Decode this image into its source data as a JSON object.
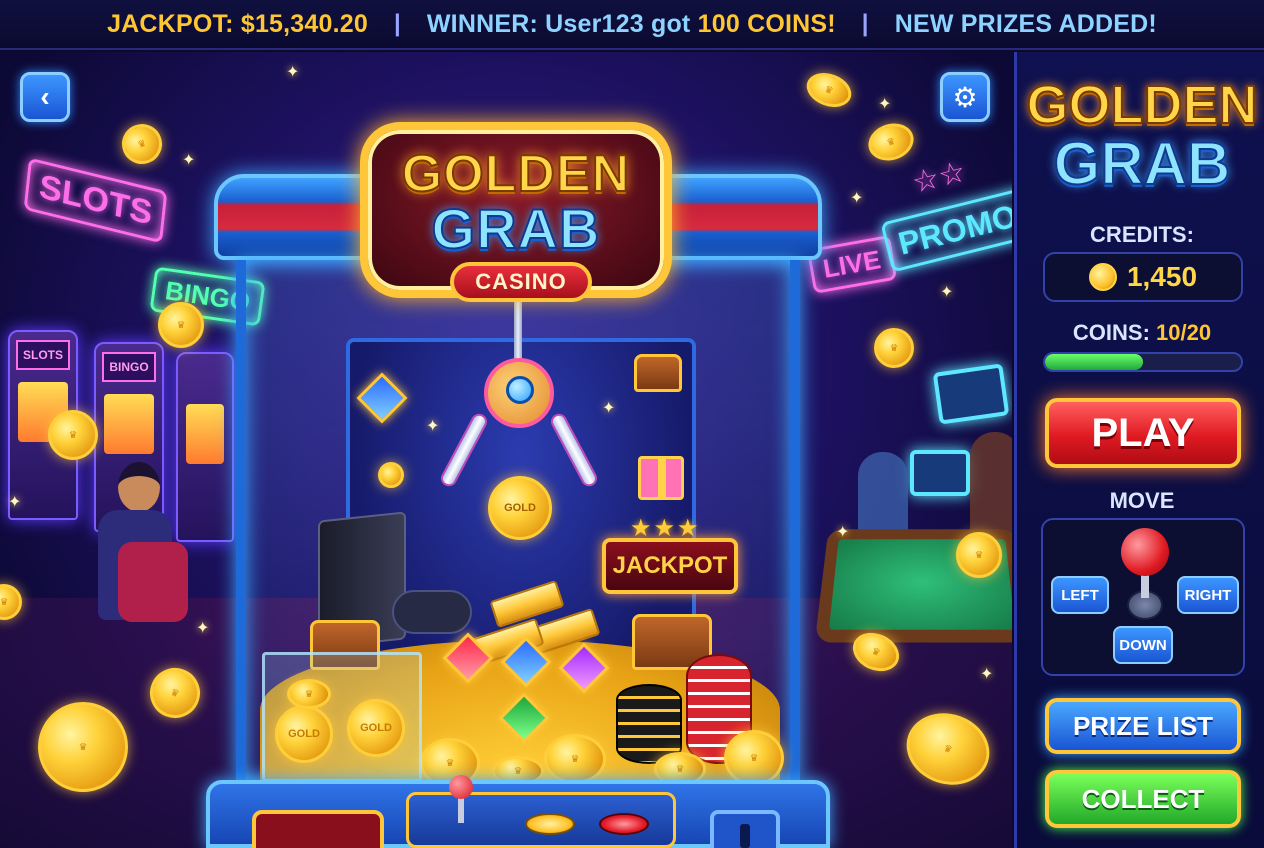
{
  "ticker": {
    "jackpot": "JACKPOT: $15,340.20",
    "separator": "|",
    "winner_prefix": "WINNER: User123 got",
    "winner_amount": "100 COINS!",
    "news": "NEW PRIZES ADDED!"
  },
  "scene": {
    "signs": {
      "slots": "SLOTS",
      "bingo": "BINGO",
      "live": "LIVE",
      "promos": "PROMOS"
    },
    "slot_machine_label_1": "SLOTS",
    "slot_machine_label_2": "BINGO",
    "marquee": {
      "title_line1": "GOLDEN",
      "title_line2": "GRAB",
      "badge": "CASINO"
    },
    "claw_coin_text": "GOLD",
    "jackpot_sign": "JACKPOT",
    "pile_coin_text": "GOLD"
  },
  "sidebar": {
    "title_line1": "GOLDEN",
    "title_line2": "GRAB",
    "credits_label": "CREDITS:",
    "credits_value": "1,450",
    "coins_label": "COINS:",
    "coins_value": "10/20",
    "coins_progress": 0.5,
    "play_label": "PLAY",
    "move_label": "MOVE",
    "left_label": "LEFT",
    "right_label": "RIGHT",
    "down_label": "DOWN",
    "prize_list_label": "PRIZE LIST",
    "collect_label": "COLLECT"
  },
  "icons": {
    "back": "back-icon",
    "settings": "gear-icon",
    "credit_coin": "coin-icon"
  },
  "colors": {
    "gold": "#ffc633",
    "accent_blue": "#8ed3ff",
    "play_red": "#e01a22",
    "collect_green": "#22a82a",
    "prize_blue": "#1a55d4"
  }
}
